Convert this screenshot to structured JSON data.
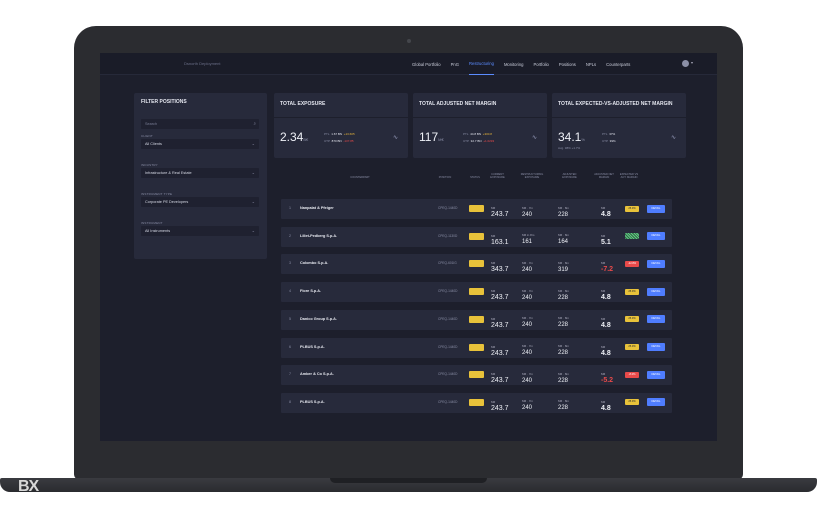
{
  "app": {
    "brand": "Dsnorth Deployment"
  },
  "nav": {
    "items": [
      "Global Portfolio",
      "PnG",
      "Restructuring",
      "Monitoring",
      "Portfolio",
      "Positions",
      "NPLs",
      "Counterparts"
    ],
    "active": "Restructuring"
  },
  "filter": {
    "title": "FILTER POSITIONS",
    "search_placeholder": "Search",
    "fields": [
      {
        "label": "CLIENT",
        "value": "All Clients"
      },
      {
        "label": "INDUSTRY",
        "value": "Infrastructure & Real Estate"
      },
      {
        "label": "INSTRUMENT TYPE",
        "value": "Corporate PE Developers"
      },
      {
        "label": "INSTRUMENT",
        "value": "All Instruments"
      }
    ]
  },
  "kpis": [
    {
      "title": "TOTAL EXPOSURE",
      "value": "2.34",
      "unit": "B€",
      "sub1_label": "PTL",
      "sub1_value": "1.67 BN",
      "sub1_delta": "+13.605",
      "sub2_label": "UTP",
      "sub2_value": "870 BN",
      "sub2_delta": "-137.85"
    },
    {
      "title": "TOTAL ADJUSTED NET MARGIN",
      "value": "117",
      "unit": "M€",
      "sub1_label": "PTL",
      "sub1_value": "44.8 BN",
      "sub1_delta": "+300.8",
      "sub2_label": "UTP",
      "sub2_value": "32.7 BN",
      "sub2_delta": "+1.0293"
    },
    {
      "title": "TOTAL EXPECTED-VS-ADJUSTED NET MARGIN",
      "value": "34.1",
      "unit": "%",
      "sub1_label": "PTL",
      "sub1_value": "37%",
      "sub1_delta": "",
      "sub2_label": "UTP",
      "sub2_value": "39%",
      "sub2_delta": "",
      "note": "Avg. 38% +1.7%"
    }
  ],
  "table": {
    "headers": [
      "COUNTERPART",
      "POSITION",
      "STATUS",
      "CURRENT EXPOSURE",
      "RESTRUCTURING EXPOSURE",
      "ADJUSTED EXPOSURE",
      "ADJUSTED NET MARGIN",
      "EXPECTED VS ACT. MARGIN"
    ],
    "rows": [
      {
        "idx": "1",
        "name": "Nanpalat & Pfeiger",
        "position": "CPEQ-1440D",
        "v1": "243.7",
        "v2": "240",
        "v2s": "M€ · 7m",
        "v3": "228",
        "v3s": "M€ · 8m",
        "v4": "4.8",
        "pill": "25.0%",
        "pill_kind": "y",
        "neg": false
      },
      {
        "idx": "2",
        "name": "Lillet-Pedberg S.p.A.",
        "position": "CPEQ-1130D",
        "v1": "163.1",
        "v2": "161",
        "v2s": "M€ in 8m",
        "v3": "164",
        "v3s": "M€ · 8m",
        "v4": "5.1",
        "pill": "",
        "pill_kind": "g",
        "neg": false
      },
      {
        "idx": "3",
        "name": "Colombo S.p.A.",
        "position": "CPEQ-601IG",
        "v1": "343.7",
        "v2": "240",
        "v2s": "M€ · 7m",
        "v3": "319",
        "v3s": "M€ · 8m",
        "v4": "-7.2",
        "pill": "-22.8%",
        "pill_kind": "r",
        "neg": true
      },
      {
        "idx": "4",
        "name": "Fiore S.p.A.",
        "position": "CPEQ-1440D",
        "v1": "243.7",
        "v2": "240",
        "v2s": "M€ · 7m",
        "v3": "228",
        "v3s": "M€ · 8m",
        "v4": "4.8",
        "pill": "25.0%",
        "pill_kind": "y",
        "neg": false
      },
      {
        "idx": "5",
        "name": "Danico Group S.p.A.",
        "position": "CPEQ-1440D",
        "v1": "243.7",
        "v2": "240",
        "v2s": "M€ · 7m",
        "v3": "228",
        "v3s": "M€ · 8m",
        "v4": "4.8",
        "pill": "25.0%",
        "pill_kind": "y",
        "neg": false
      },
      {
        "idx": "6",
        "name": "PLBUS S.p.A.",
        "position": "CPEQ-1440D",
        "v1": "243.7",
        "v2": "240",
        "v2s": "M€ · 7m",
        "v3": "228",
        "v3s": "M€ · 8m",
        "v4": "4.8",
        "pill": "25.0%",
        "pill_kind": "y",
        "neg": false
      },
      {
        "idx": "7",
        "name": "Amber & Co S.p.A.",
        "position": "CPEQ-1440D",
        "v1": "243.7",
        "v2": "240",
        "v2s": "M€ · 7m",
        "v3": "228",
        "v3s": "M€ · 8m",
        "v4": "-5.2",
        "pill": "-8.2%",
        "pill_kind": "r",
        "neg": true
      },
      {
        "idx": "8",
        "name": "PLBUS S.p.A.",
        "position": "CPEQ-1440D",
        "v1": "243.7",
        "v2": "240",
        "v2s": "M€ · 7m",
        "v3": "228",
        "v3s": "M€ · 8m",
        "v4": "4.8",
        "pill": "25.0%",
        "pill_kind": "y",
        "neg": false
      }
    ],
    "action_label": "DETAIL",
    "unit_v1": "M€",
    "unit_v4": "M€"
  },
  "colors": {
    "accent": "#5b8cff",
    "status_yellow": "#e8c23a",
    "negative": "#e84a4a",
    "positive": "#62c483"
  },
  "watermark": "BX"
}
